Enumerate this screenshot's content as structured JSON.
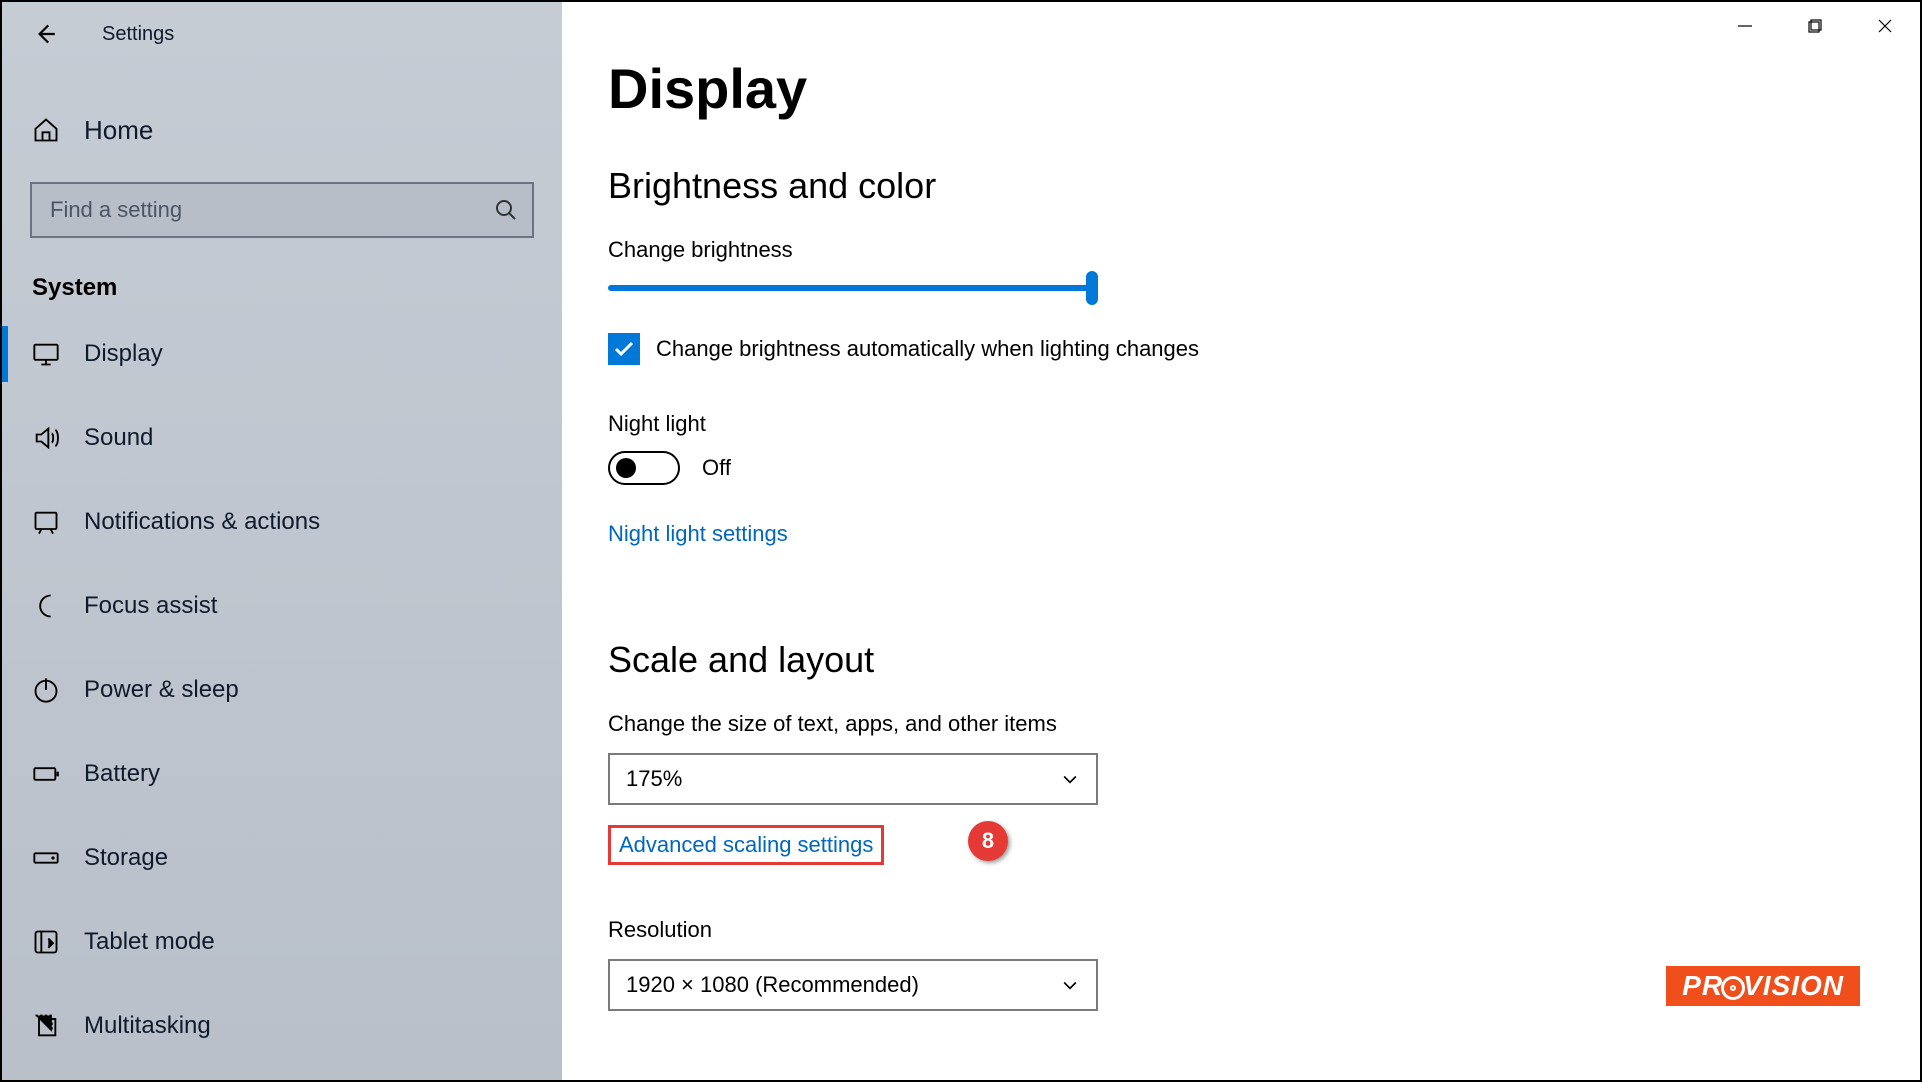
{
  "window": {
    "app_title": "Settings"
  },
  "sidebar": {
    "home": "Home",
    "search_placeholder": "Find a setting",
    "category": "System",
    "items": [
      {
        "key": "display",
        "label": "Display",
        "icon": "monitor-icon",
        "active": true
      },
      {
        "key": "sound",
        "label": "Sound",
        "icon": "sound-icon"
      },
      {
        "key": "notifications",
        "label": "Notifications & actions",
        "icon": "notification-icon"
      },
      {
        "key": "focus_assist",
        "label": "Focus assist",
        "icon": "moon-icon"
      },
      {
        "key": "power_sleep",
        "label": "Power & sleep",
        "icon": "power-icon"
      },
      {
        "key": "battery",
        "label": "Battery",
        "icon": "battery-icon"
      },
      {
        "key": "storage",
        "label": "Storage",
        "icon": "storage-icon"
      },
      {
        "key": "tablet",
        "label": "Tablet mode",
        "icon": "tablet-icon"
      },
      {
        "key": "multitasking",
        "label": "Multitasking",
        "icon": "multitask-icon"
      }
    ]
  },
  "main": {
    "title": "Display",
    "sec1": "Brightness and color",
    "brightness_label": "Change brightness",
    "brightness_percent": 100,
    "auto_brightness_label": "Change brightness automatically when lighting changes",
    "auto_brightness_checked": true,
    "night_light_label": "Night light",
    "night_light_state": "Off",
    "night_light_on": false,
    "night_light_link": "Night light settings",
    "sec2": "Scale and layout",
    "scale_label": "Change the size of text, apps, and other items",
    "scale_value": "175%",
    "adv_scale_link": "Advanced scaling settings",
    "resolution_label": "Resolution",
    "resolution_value": "1920 × 1080 (Recommended)"
  },
  "annotation": {
    "number": "8"
  },
  "watermark": {
    "pre": "PR",
    "post": "VISION"
  }
}
